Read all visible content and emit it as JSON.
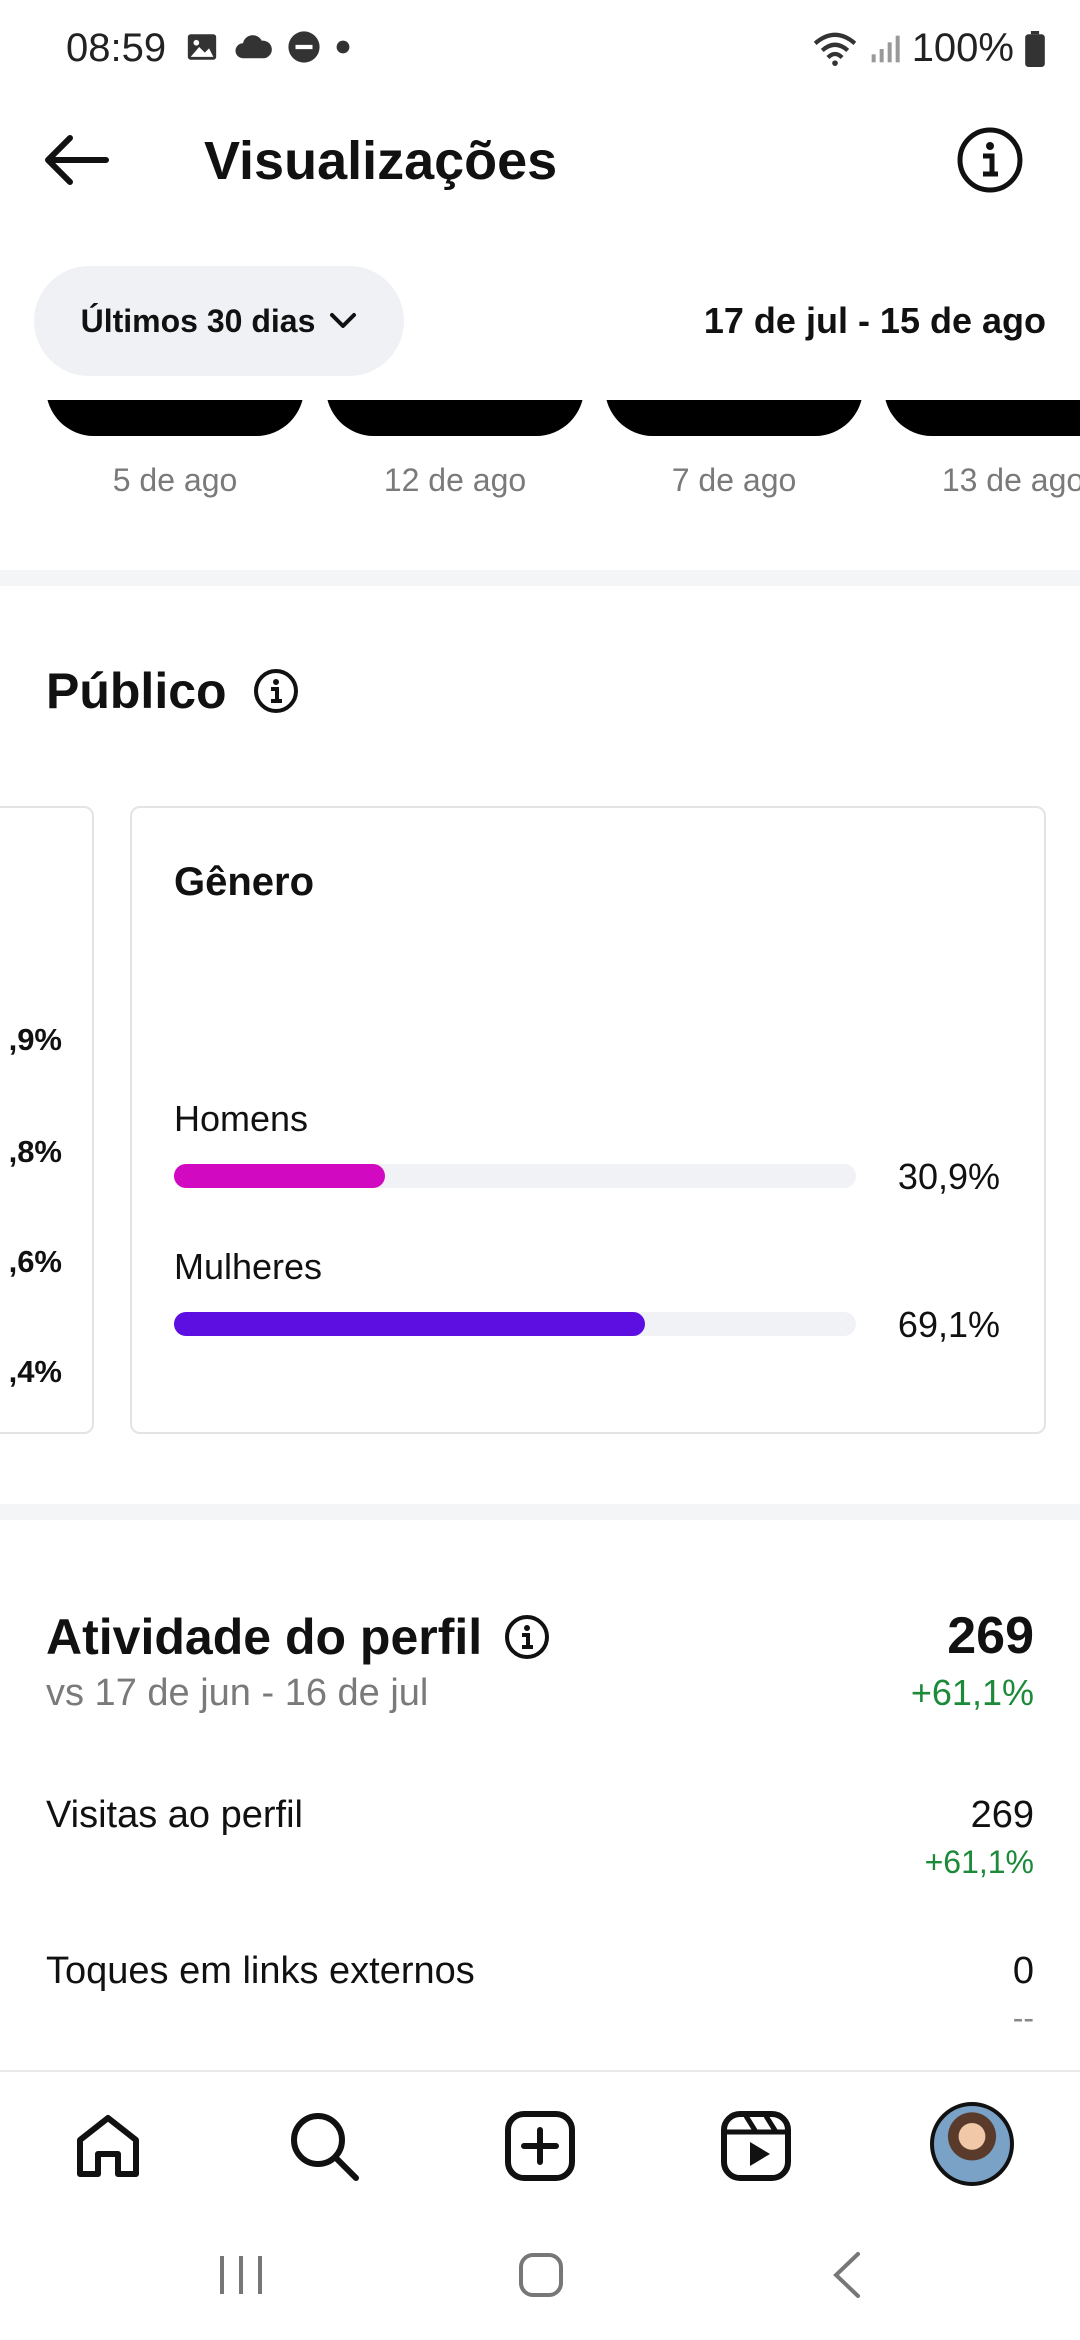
{
  "status_bar": {
    "time": "08:59",
    "battery": "100%",
    "icons": [
      "image-icon",
      "cloud-icon",
      "dnd-icon",
      "dot-icon",
      "wifi-icon",
      "signal-icon",
      "battery-icon"
    ]
  },
  "header": {
    "title": "Visualizações",
    "back_icon": "arrow-left-icon",
    "info_icon": "info-icon"
  },
  "filter": {
    "selected": "Últimos 30 dias",
    "date_range": "17 de jul - 15 de ago"
  },
  "thumbnails": [
    {
      "date": "5 de ago"
    },
    {
      "date": "12 de ago"
    },
    {
      "date": "7 de ago"
    },
    {
      "date": "13 de ago"
    }
  ],
  "audience": {
    "title": "Público",
    "left_card_values": [
      ",9%",
      ",8%",
      ",6%",
      ",4%"
    ],
    "gender_card": {
      "title": "Gênero",
      "items": [
        {
          "label": "Homens",
          "percent_text": "30,9%",
          "value": 30.9,
          "color": "#d10ac1"
        },
        {
          "label": "Mulheres",
          "percent_text": "69,1%",
          "value": 69.1,
          "color": "#5c0fe0"
        }
      ]
    }
  },
  "activity": {
    "title": "Atividade do perfil",
    "comparison": "vs 17 de jun - 16 de jul",
    "total": "269",
    "total_delta": "+61,1%",
    "rows": [
      {
        "label": "Visitas ao perfil",
        "value": "269",
        "delta": "+61,1%"
      },
      {
        "label": "Toques em links externos",
        "value": "0",
        "delta": "--"
      }
    ]
  },
  "bottom_nav": [
    "home-icon",
    "search-icon",
    "create-icon",
    "reels-icon",
    "profile-avatar"
  ],
  "colors": {
    "positive": "#1d8a3a",
    "men": "#d10ac1",
    "women": "#5c0fe0"
  }
}
